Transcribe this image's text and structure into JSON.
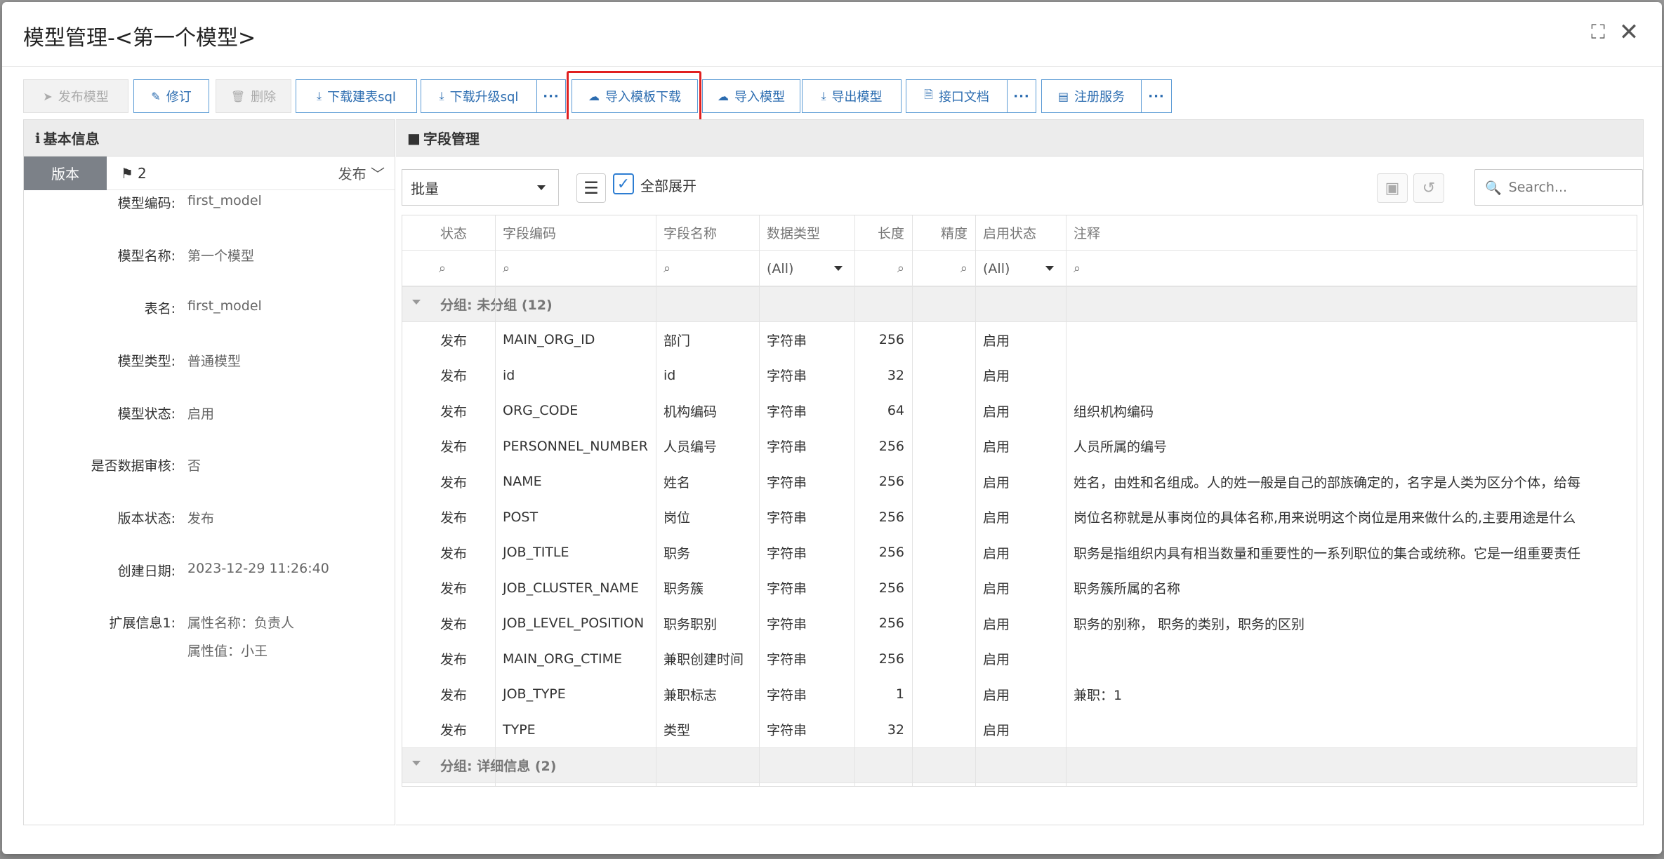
{
  "modal": {
    "title": "模型管理-<第一个模型>"
  },
  "toolbar": {
    "publish": "发布模型",
    "revise": "修订",
    "delete": "删除",
    "download_create_sql": "下载建表sql",
    "download_upgrade_sql": "下载升级sql",
    "more": "···",
    "import_template_download": "导入模板下载",
    "import_model": "导入模型",
    "export_model": "导出模型",
    "api_doc": "接口文档",
    "register_service": "注册服务"
  },
  "left": {
    "header": "基本信息",
    "version_tab": "版本",
    "version_num": "2",
    "version_status": "发布",
    "fields": [
      {
        "label": "模型编码:",
        "value": "first_model"
      },
      {
        "label": "模型名称:",
        "value": "第一个模型"
      },
      {
        "label": "表名:",
        "value": "first_model"
      },
      {
        "label": "模型类型:",
        "value": "普通模型"
      },
      {
        "label": "模型状态:",
        "value": "启用"
      },
      {
        "label": "是否数据审核:",
        "value": "否"
      },
      {
        "label": "版本状态:",
        "value": "发布"
      },
      {
        "label": "创建日期:",
        "value": "2023-12-29 11:26:40"
      },
      {
        "label": "扩展信息1:",
        "value": "属性名称：负责人",
        "value2": "属性值：小王"
      }
    ]
  },
  "right": {
    "header": "字段管理",
    "batch": "批量",
    "expand_all": "全部展开",
    "search_placeholder": "Search...",
    "columns": [
      "状态",
      "字段编码",
      "字段名称",
      "数据类型",
      "长度",
      "精度",
      "启用状态",
      "注释"
    ],
    "filter_all": "(All)",
    "groups": [
      {
        "label": "分组: 未分组 (12)"
      },
      {
        "label": "分组: 详细信息 (2)"
      }
    ],
    "rows": [
      {
        "status": "发布",
        "code": "MAIN_ORG_ID",
        "name": "部门",
        "type": "字符串",
        "length": "256",
        "precision": "",
        "enabled": "启用",
        "comment": ""
      },
      {
        "status": "发布",
        "code": "id",
        "name": "id",
        "type": "字符串",
        "length": "32",
        "precision": "",
        "enabled": "启用",
        "comment": ""
      },
      {
        "status": "发布",
        "code": "ORG_CODE",
        "name": "机构编码",
        "type": "字符串",
        "length": "64",
        "precision": "",
        "enabled": "启用",
        "comment": "组织机构编码"
      },
      {
        "status": "发布",
        "code": "PERSONNEL_NUMBER",
        "name": "人员编号",
        "type": "字符串",
        "length": "256",
        "precision": "",
        "enabled": "启用",
        "comment": "人员所属的编号"
      },
      {
        "status": "发布",
        "code": "NAME",
        "name": "姓名",
        "type": "字符串",
        "length": "256",
        "precision": "",
        "enabled": "启用",
        "comment": "姓名，由姓和名组成。人的姓一般是自己的部族确定的，名字是人类为区分个体，给每"
      },
      {
        "status": "发布",
        "code": "POST",
        "name": "岗位",
        "type": "字符串",
        "length": "256",
        "precision": "",
        "enabled": "启用",
        "comment": "岗位名称就是从事岗位的具体名称,用来说明这个岗位是用来做什么的,主要用途是什么"
      },
      {
        "status": "发布",
        "code": "JOB_TITLE",
        "name": "职务",
        "type": "字符串",
        "length": "256",
        "precision": "",
        "enabled": "启用",
        "comment": "职务是指组织内具有相当数量和重要性的一系列职位的集合或统称。它是一组重要责任"
      },
      {
        "status": "发布",
        "code": "JOB_CLUSTER_NAME",
        "name": "职务簇",
        "type": "字符串",
        "length": "256",
        "precision": "",
        "enabled": "启用",
        "comment": "职务簇所属的名称"
      },
      {
        "status": "发布",
        "code": "JOB_LEVEL_POSITION",
        "name": "职务职别",
        "type": "字符串",
        "length": "256",
        "precision": "",
        "enabled": "启用",
        "comment": "职务的别称， 职务的类别，职务的区别"
      },
      {
        "status": "发布",
        "code": "MAIN_ORG_CTIME",
        "name": "兼职创建时间",
        "type": "字符串",
        "length": "256",
        "precision": "",
        "enabled": "启用",
        "comment": ""
      },
      {
        "status": "发布",
        "code": "JOB_TYPE",
        "name": "兼职标志",
        "type": "字符串",
        "length": "1",
        "precision": "",
        "enabled": "启用",
        "comment": "兼职：1"
      },
      {
        "status": "发布",
        "code": "TYPE",
        "name": "类型",
        "type": "字符串",
        "length": "32",
        "precision": "",
        "enabled": "启用",
        "comment": ""
      }
    ]
  }
}
